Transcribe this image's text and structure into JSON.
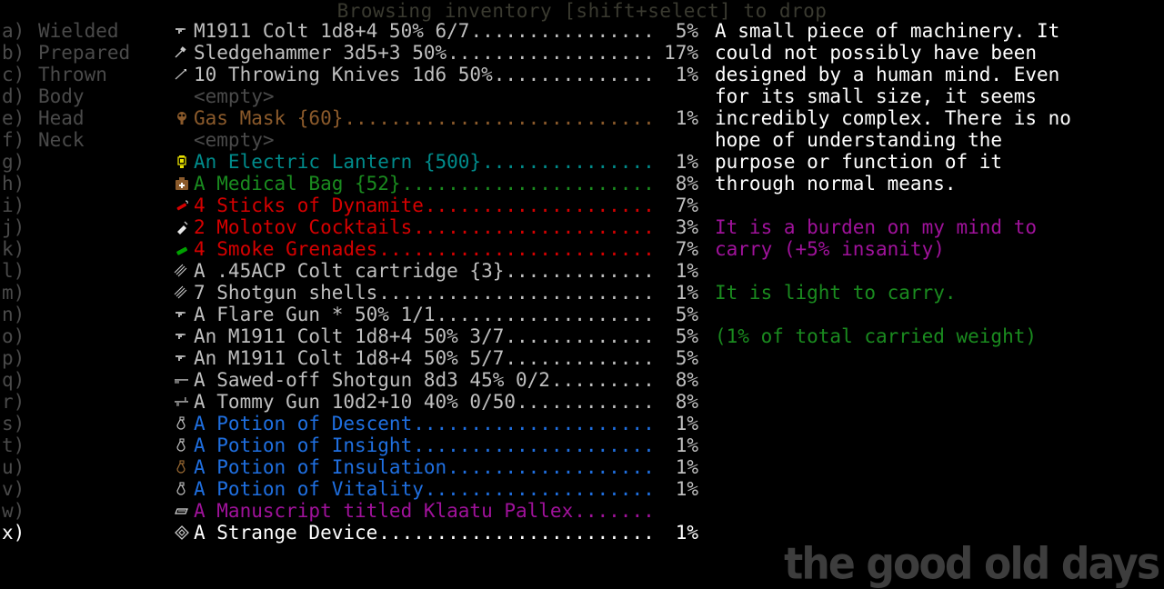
{
  "header": {
    "title": "Browsing inventory [shift+select] to drop"
  },
  "colors": {
    "background": "#000000",
    "dim": "#4a4a4a",
    "normal": "#bfbfbf",
    "selected": "#ffffff",
    "teal": "#008b8b",
    "green": "#1a8b1f",
    "red": "#d60000",
    "blue": "#1f6fe0",
    "magenta": "#a0129b",
    "brown": "#8b5a2b",
    "title": "#3a3a30",
    "watermark": "#3d3d3d"
  },
  "inventory": {
    "rows": [
      {
        "key": "a)",
        "slot": "Wielded",
        "icon": "pistol-icon",
        "label": "M1911 Colt 1d8+4 50% 6/7",
        "pct": "5%",
        "color": "normal",
        "empty": false,
        "selected": false
      },
      {
        "key": "b)",
        "slot": "Prepared",
        "icon": "sledgehammer-icon",
        "label": "Sledgehammer 3d5+3 50%",
        "pct": "17%",
        "color": "normal",
        "empty": false,
        "selected": false
      },
      {
        "key": "c)",
        "slot": "Thrown",
        "icon": "knife-icon",
        "label": "10 Throwing Knives 1d6 50%",
        "pct": "1%",
        "color": "normal",
        "empty": false,
        "selected": false
      },
      {
        "key": "d)",
        "slot": "Body",
        "icon": "",
        "label": "<empty>",
        "pct": "",
        "color": "dim",
        "empty": true,
        "selected": false
      },
      {
        "key": "e)",
        "slot": "Head",
        "icon": "gasmask-icon",
        "label": "Gas Mask {60}",
        "pct": "1%",
        "color": "brown",
        "empty": false,
        "selected": false
      },
      {
        "key": "f)",
        "slot": "Neck",
        "icon": "",
        "label": "<empty>",
        "pct": "",
        "color": "dim",
        "empty": true,
        "selected": false
      },
      {
        "key": "g)",
        "slot": "",
        "icon": "lantern-icon",
        "label": "An Electric Lantern {500}",
        "pct": "1%",
        "color": "teal",
        "empty": false,
        "selected": false
      },
      {
        "key": "h)",
        "slot": "",
        "icon": "medbag-icon",
        "label": "A Medical Bag {52}",
        "pct": "8%",
        "color": "green",
        "empty": false,
        "selected": false
      },
      {
        "key": "i)",
        "slot": "",
        "icon": "dynamite-icon",
        "label": "4 Sticks of Dynamite",
        "pct": "7%",
        "color": "red",
        "empty": false,
        "selected": false
      },
      {
        "key": "j)",
        "slot": "",
        "icon": "molotov-icon",
        "label": "2 Molotov Cocktails",
        "pct": "3%",
        "color": "red",
        "empty": false,
        "selected": false
      },
      {
        "key": "k)",
        "slot": "",
        "icon": "grenade-icon",
        "label": "4 Smoke Grenades",
        "pct": "7%",
        "color": "red",
        "empty": false,
        "selected": false
      },
      {
        "key": "l)",
        "slot": "",
        "icon": "ammo-icon",
        "label": "A .45ACP Colt cartridge {3}",
        "pct": "1%",
        "color": "normal",
        "empty": false,
        "selected": false
      },
      {
        "key": "m)",
        "slot": "",
        "icon": "ammo-icon",
        "label": "7 Shotgun shells",
        "pct": "1%",
        "color": "normal",
        "empty": false,
        "selected": false
      },
      {
        "key": "n)",
        "slot": "",
        "icon": "pistol-icon",
        "label": "A Flare Gun * 50% 1/1",
        "pct": "5%",
        "color": "normal",
        "empty": false,
        "selected": false
      },
      {
        "key": "o)",
        "slot": "",
        "icon": "pistol-icon",
        "label": "An M1911 Colt 1d8+4 50% 3/7",
        "pct": "5%",
        "color": "normal",
        "empty": false,
        "selected": false
      },
      {
        "key": "p)",
        "slot": "",
        "icon": "pistol-icon",
        "label": "An M1911 Colt 1d8+4 50% 5/7",
        "pct": "5%",
        "color": "normal",
        "empty": false,
        "selected": false
      },
      {
        "key": "q)",
        "slot": "",
        "icon": "shotgun-icon",
        "label": "A Sawed-off Shotgun 8d3 45% 0/2",
        "pct": "8%",
        "color": "normal",
        "empty": false,
        "selected": false
      },
      {
        "key": "r)",
        "slot": "",
        "icon": "tommygun-icon",
        "label": "A Tommy Gun 10d2+10 40% 0/50",
        "pct": "8%",
        "color": "normal",
        "empty": false,
        "selected": false
      },
      {
        "key": "s)",
        "slot": "",
        "icon": "potion-icon",
        "label": "A Potion of Descent",
        "pct": "1%",
        "color": "blue",
        "empty": false,
        "selected": false
      },
      {
        "key": "t)",
        "slot": "",
        "icon": "potion-icon",
        "label": "A Potion of Insight",
        "pct": "1%",
        "color": "blue",
        "empty": false,
        "selected": false
      },
      {
        "key": "u)",
        "slot": "",
        "icon": "potion-brown-icon",
        "label": "A Potion of Insulation",
        "pct": "1%",
        "color": "blue",
        "empty": false,
        "selected": false
      },
      {
        "key": "v)",
        "slot": "",
        "icon": "potion-icon",
        "label": "A Potion of Vitality",
        "pct": "1%",
        "color": "blue",
        "empty": false,
        "selected": false
      },
      {
        "key": "w)",
        "slot": "",
        "icon": "scroll-icon",
        "label": "A Manuscript titled Klaatu Pallex",
        "pct": "",
        "color": "magenta",
        "empty": false,
        "selected": false
      },
      {
        "key": "x)",
        "slot": "",
        "icon": "device-icon",
        "label": "A Strange Device",
        "pct": "1%",
        "color": "selected",
        "empty": false,
        "selected": true
      }
    ]
  },
  "description": {
    "main": "A small piece of machinery. It\ncould not possibly have been\ndesigned by a human mind. Even\nfor its small size, it seems\nincredibly complex. There is no\nhope of understanding the\npurpose or function of it\nthrough normal means.",
    "burden": "It is a burden on my mind to\ncarry (+5% insanity)",
    "light": "It is light to carry.",
    "weight": "(1% of total carried weight)"
  },
  "watermark": {
    "text": "the good old days"
  }
}
